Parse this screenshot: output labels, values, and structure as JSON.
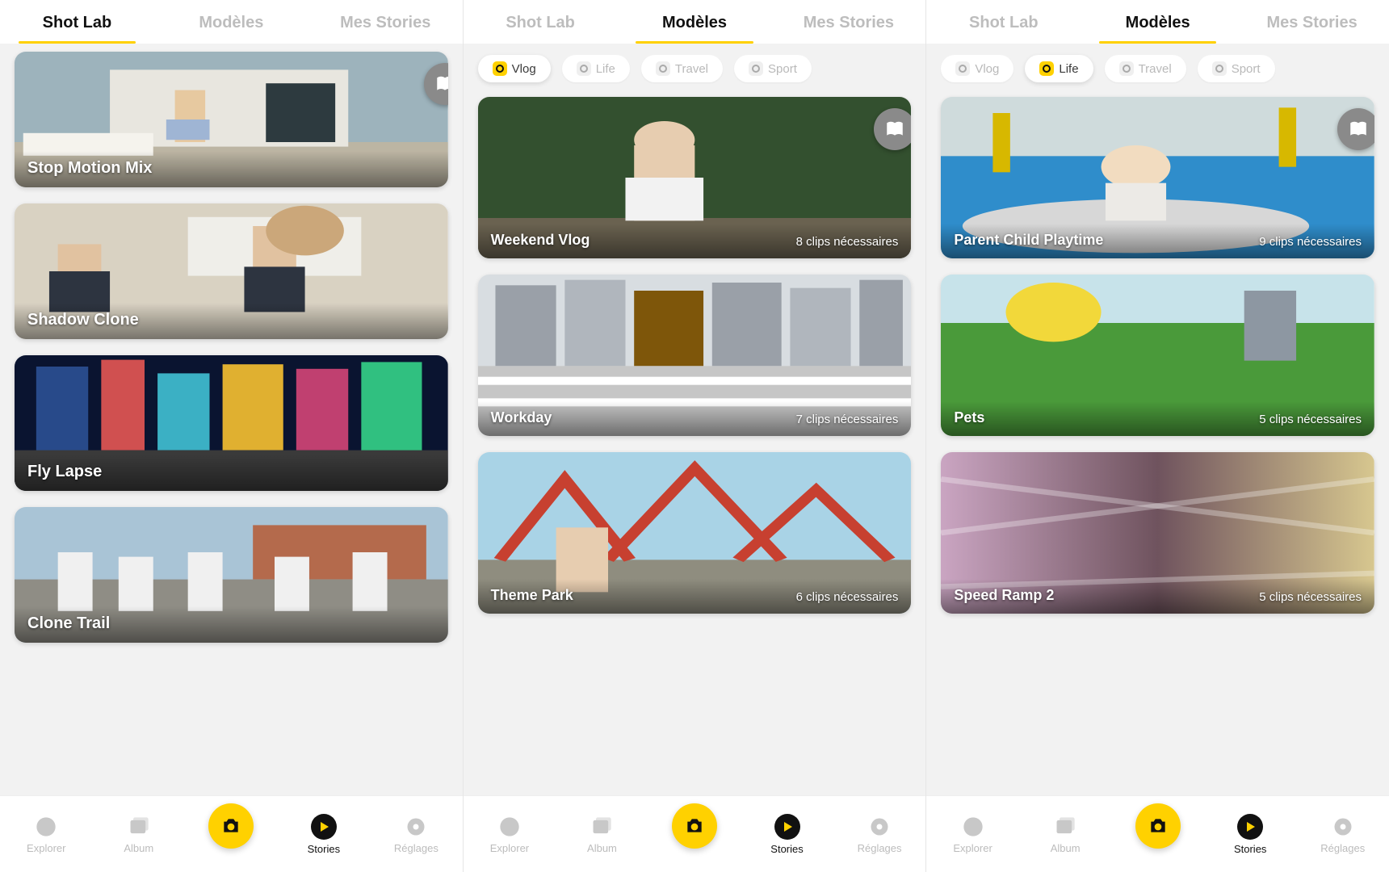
{
  "tabs": {
    "shot_lab": "Shot Lab",
    "modeles": "Modèles",
    "mes_stories": "Mes Stories"
  },
  "pills": {
    "vlog": "Vlog",
    "life": "Life",
    "travel": "Travel",
    "sport": "Sport"
  },
  "bottom": {
    "explorer": "Explorer",
    "album": "Album",
    "stories": "Stories",
    "reglages": "Réglages"
  },
  "screen0": {
    "active_tab": "shot_lab",
    "cards": [
      {
        "title": "Stop Motion Mix"
      },
      {
        "title": "Shadow Clone"
      },
      {
        "title": "Fly Lapse"
      },
      {
        "title": "Clone Trail"
      }
    ]
  },
  "screen1": {
    "active_tab": "modeles",
    "active_pill": "vlog",
    "cards": [
      {
        "title": "Weekend Vlog",
        "meta": "8 clips nécessaires"
      },
      {
        "title": "Workday",
        "meta": "7 clips nécessaires"
      },
      {
        "title": "Theme Park",
        "meta": "6 clips nécessaires"
      }
    ]
  },
  "screen2": {
    "active_tab": "modeles",
    "active_pill": "life",
    "cards": [
      {
        "title": "Parent Child Playtime",
        "meta": "9 clips nécessaires"
      },
      {
        "title": "Pets",
        "meta": "5 clips nécessaires"
      },
      {
        "title": "Speed Ramp 2",
        "meta": "5 clips nécessaires"
      }
    ]
  }
}
